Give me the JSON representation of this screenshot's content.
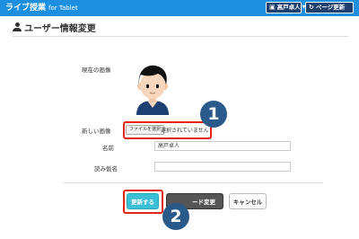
{
  "header": {
    "brand": "ライブ授業",
    "brand_sub": "for Tablet",
    "user_name": "高戸卓人",
    "refresh_label": "ページ更新"
  },
  "page": {
    "title": "ユーザー情報変更"
  },
  "form": {
    "current_image_label": "現在の画像",
    "new_image_label": "新しい画像",
    "file_button_label": "ファイルを選択",
    "file_status": "選択されていません",
    "name_label": "名前",
    "name_value": "高戸卓人",
    "kana_label": "読み仮名",
    "kana_value": ""
  },
  "buttons": {
    "update_label": "更新する",
    "password_label": "ード変更",
    "cancel_label": "キャンセル"
  },
  "annotations": {
    "callout_1": "1",
    "callout_2": "2"
  },
  "colors": {
    "topbar": "#1d8fe0",
    "accent_update": "#3bbfd4",
    "highlight_red": "#e2231a",
    "callout_badge": "#2a5a8a"
  }
}
